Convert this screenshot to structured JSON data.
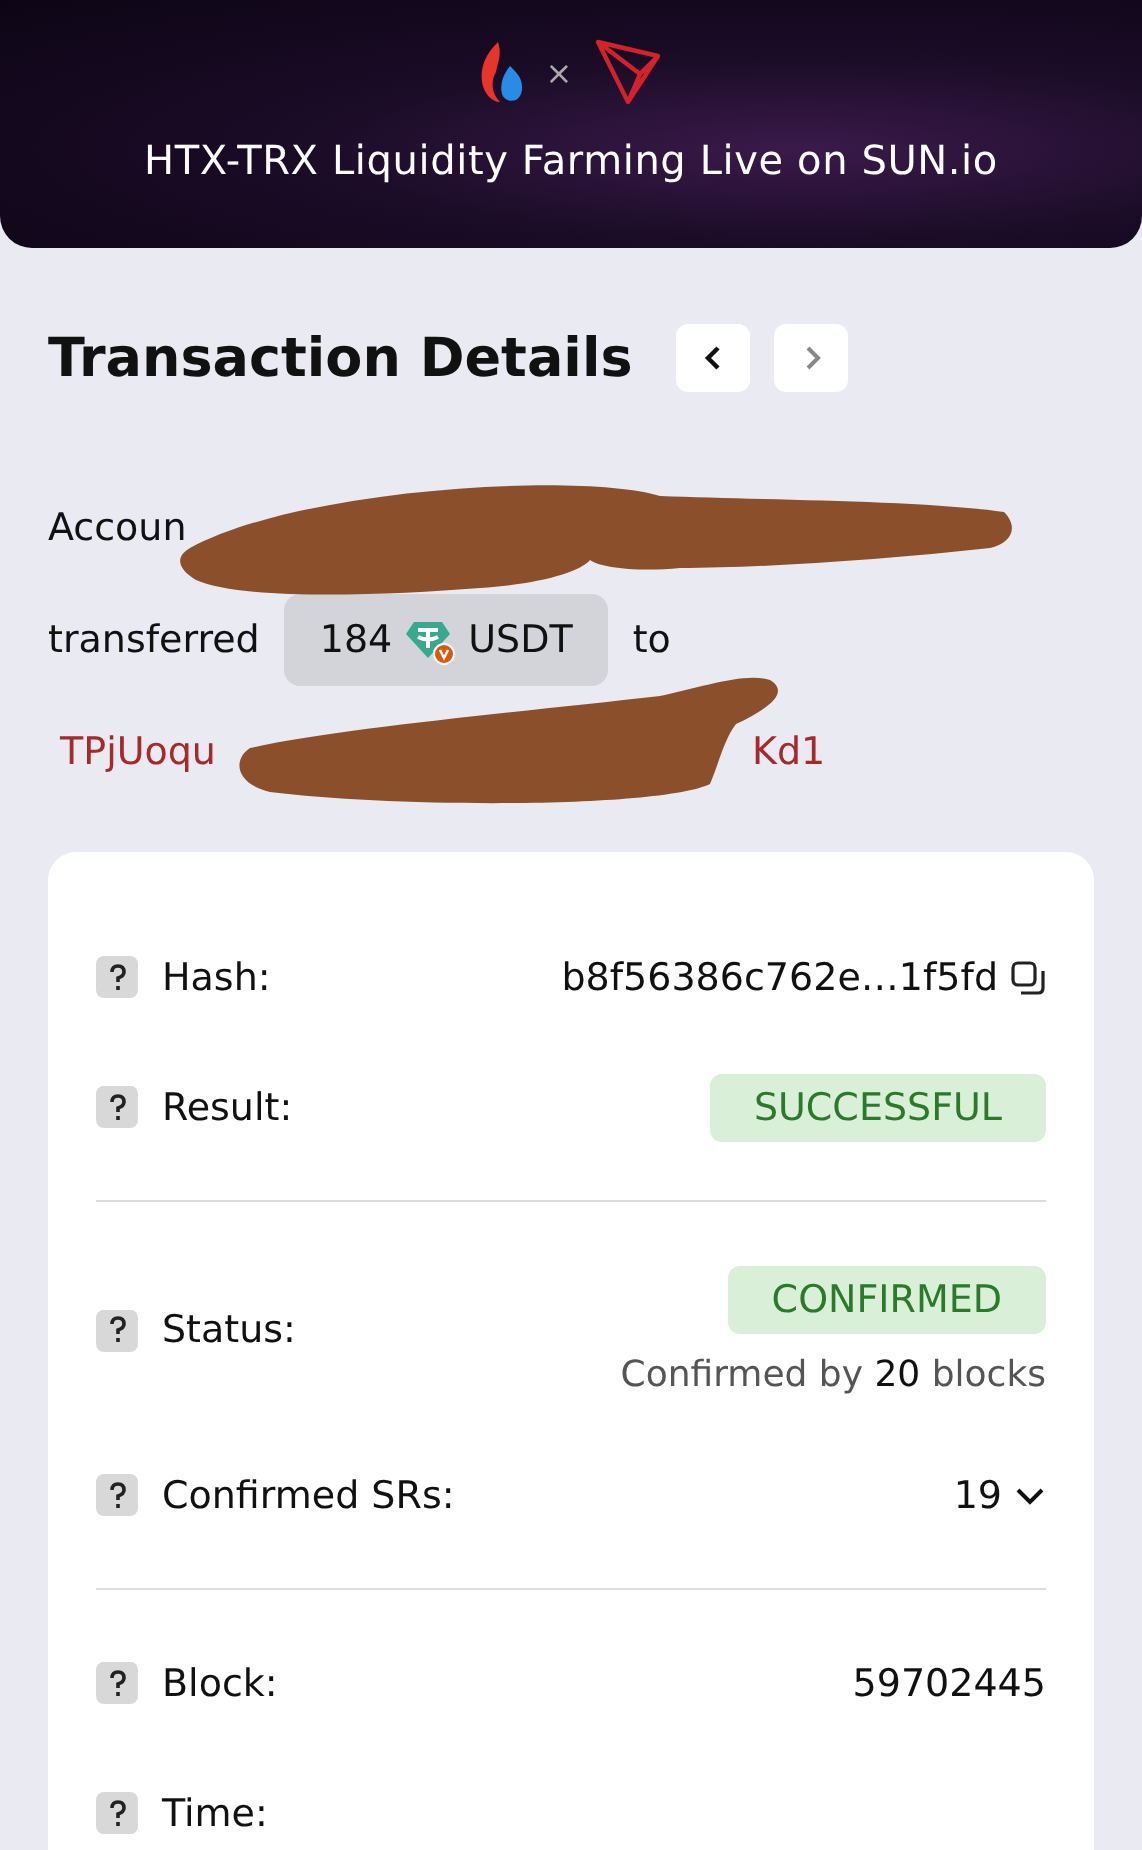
{
  "banner": {
    "title": "HTX-TRX Liquidity Farming Live on SUN.io",
    "separator": "×"
  },
  "page_title": "Transaction Details",
  "summary": {
    "account_prefix": "Accoun",
    "verb": "transferred",
    "amount": "184",
    "token": "USDT",
    "preposition": "to",
    "address_start": "TPjUoqu",
    "address_end": "Kd1"
  },
  "details": [
    {
      "kind": "text",
      "label": "Hash:",
      "value": "b8f56386c762e…1f5fd",
      "copyable": true
    },
    {
      "kind": "badge",
      "label": "Result:",
      "value": "SUCCESSFUL"
    },
    {
      "kind": "divider"
    },
    {
      "kind": "status",
      "label": "Status:",
      "value": "CONFIRMED",
      "note": "Confirmed by **20** blocks"
    },
    {
      "kind": "dropdown",
      "label": "Confirmed SRs:",
      "value": "19",
      "expanded": false
    },
    {
      "kind": "divider"
    },
    {
      "kind": "text",
      "label": "Block:",
      "value": "59702445"
    },
    {
      "kind": "text",
      "label": "Time:"
    }
  ]
}
